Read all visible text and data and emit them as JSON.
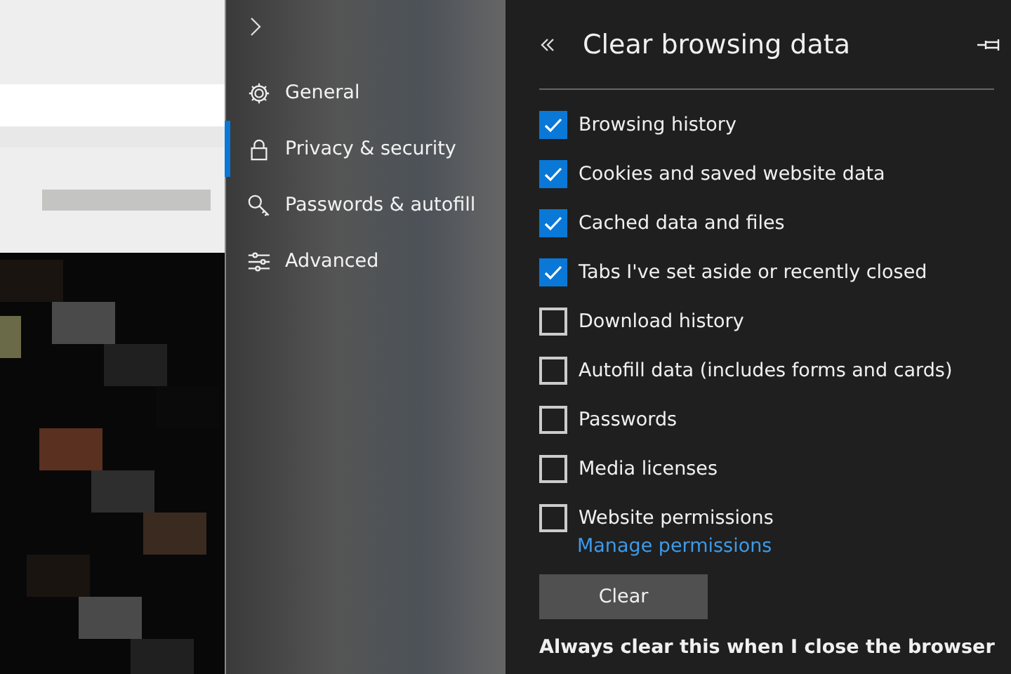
{
  "sidebar": {
    "items": [
      {
        "label": "General",
        "selected": false
      },
      {
        "label": "Privacy & security",
        "selected": true
      },
      {
        "label": "Passwords & autofill",
        "selected": false
      },
      {
        "label": "Advanced",
        "selected": false
      }
    ]
  },
  "panel": {
    "title": "Clear browsing data",
    "options": [
      {
        "label": "Browsing history",
        "checked": true
      },
      {
        "label": "Cookies and saved website data",
        "checked": true
      },
      {
        "label": "Cached data and files",
        "checked": true
      },
      {
        "label": "Tabs I've set aside or recently closed",
        "checked": true
      },
      {
        "label": "Download history",
        "checked": false
      },
      {
        "label": "Autofill data (includes forms and cards)",
        "checked": false
      },
      {
        "label": "Passwords",
        "checked": false
      },
      {
        "label": "Media licenses",
        "checked": false
      },
      {
        "label": "Website permissions",
        "checked": false
      }
    ],
    "link": "Manage permissions",
    "button": "Clear",
    "footer": "Always clear this when I close the browser"
  }
}
